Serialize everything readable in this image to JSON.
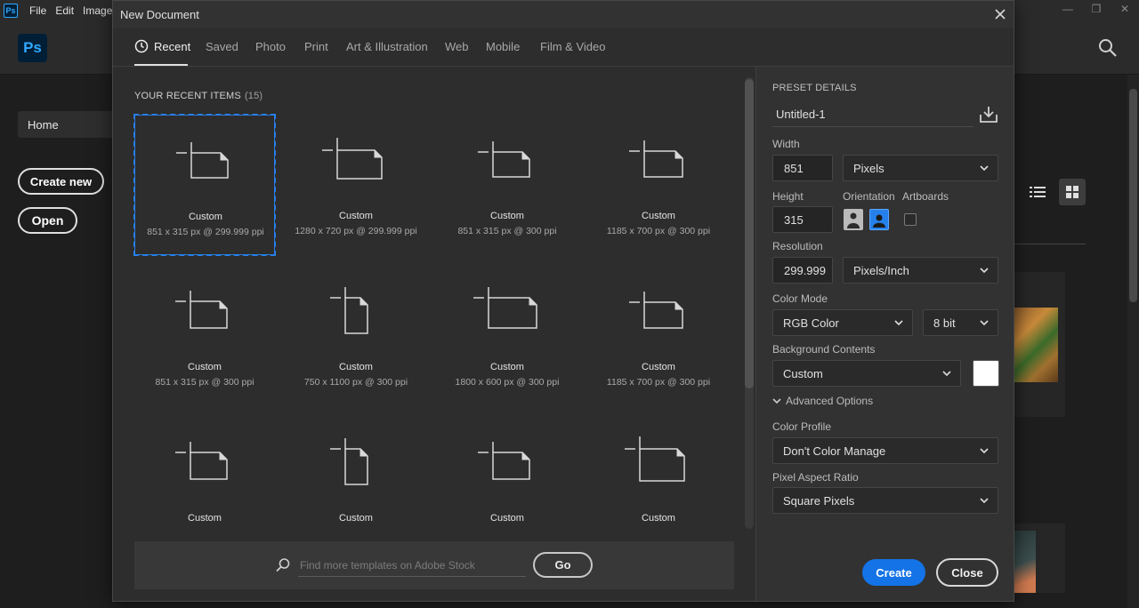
{
  "app": {
    "menu": [
      "File",
      "Edit",
      "Image"
    ],
    "home_label": "Home",
    "create_new_label": "Create new",
    "open_label": "Open",
    "logo_text": "Ps"
  },
  "dialog": {
    "title": "New Document",
    "tabs": [
      "Recent",
      "Saved",
      "Photo",
      "Print",
      "Art & Illustration",
      "Web",
      "Mobile",
      "Film & Video"
    ],
    "active_tab": "Recent",
    "recent_heading": "YOUR RECENT ITEMS",
    "recent_count": "(15)",
    "items": [
      {
        "name": "Custom",
        "desc": "851 x 315 px @ 299.999 ppi"
      },
      {
        "name": "Custom",
        "desc": "1280 x 720 px @ 299.999 ppi"
      },
      {
        "name": "Custom",
        "desc": "851 x 315 px @ 300 ppi"
      },
      {
        "name": "Custom",
        "desc": "1185 x 700 px @ 300 ppi"
      },
      {
        "name": "Custom",
        "desc": "851 x 315 px @ 300 ppi"
      },
      {
        "name": "Custom",
        "desc": "750 x 1100 px @ 300 ppi"
      },
      {
        "name": "Custom",
        "desc": "1800 x 600 px @ 300 ppi"
      },
      {
        "name": "Custom",
        "desc": "1185 x 700 px @ 300 ppi"
      },
      {
        "name": "Custom",
        "desc": ""
      },
      {
        "name": "Custom",
        "desc": ""
      },
      {
        "name": "Custom",
        "desc": ""
      },
      {
        "name": "Custom",
        "desc": ""
      }
    ],
    "stock": {
      "placeholder": "Find more templates on Adobe Stock",
      "go_label": "Go"
    },
    "preset": {
      "heading": "PRESET DETAILS",
      "name": "Untitled-1",
      "width_label": "Width",
      "width_value": "851",
      "width_unit": "Pixels",
      "height_label": "Height",
      "height_value": "315",
      "orientation_label": "Orientation",
      "artboards_label": "Artboards",
      "resolution_label": "Resolution",
      "resolution_value": "299.999",
      "resolution_unit": "Pixels/Inch",
      "color_mode_label": "Color Mode",
      "color_mode": "RGB Color",
      "bit_depth": "8 bit",
      "background_label": "Background Contents",
      "background_value": "Custom",
      "background_color": "#ffffff",
      "advanced_label": "Advanced Options",
      "color_profile_label": "Color Profile",
      "color_profile": "Don't Color Manage",
      "pixel_aspect_label": "Pixel Aspect Ratio",
      "pixel_aspect": "Square Pixels",
      "create_label": "Create",
      "close_label": "Close"
    }
  },
  "colors": {
    "accent": "#2680eb",
    "create_button": "#1473e6"
  }
}
